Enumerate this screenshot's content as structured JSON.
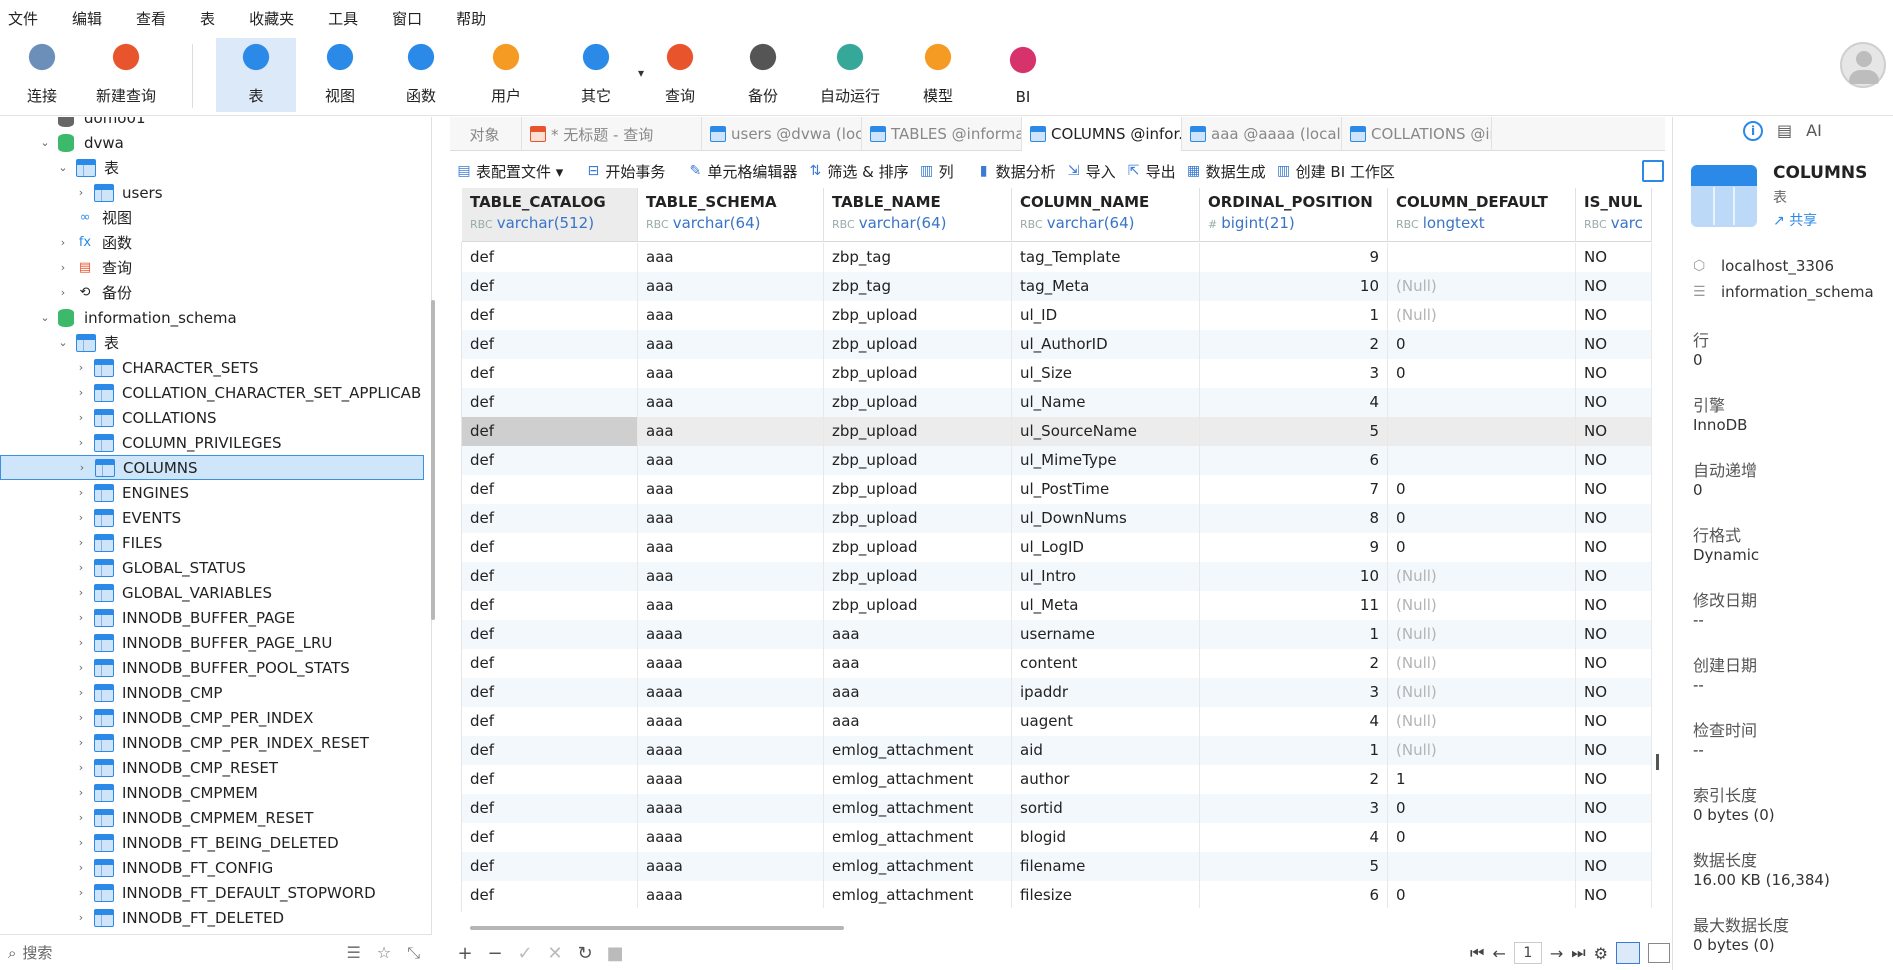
{
  "menu": [
    "文件",
    "编辑",
    "查看",
    "表",
    "收藏夹",
    "工具",
    "窗口",
    "帮助"
  ],
  "toolbar": {
    "buttons": [
      {
        "label": "连接",
        "icon": "plug-connect-icon"
      },
      {
        "label": "新建查询",
        "icon": "new-query-icon"
      },
      {
        "label": "表",
        "icon": "table-icon",
        "active": true
      },
      {
        "label": "视图",
        "icon": "view-glasses-icon"
      },
      {
        "label": "函数",
        "icon": "function-icon"
      },
      {
        "label": "用户",
        "icon": "user-icon"
      },
      {
        "label": "其它",
        "icon": "tools-icon"
      },
      {
        "label": "查询",
        "icon": "query-icon"
      },
      {
        "label": "备份",
        "icon": "backup-icon"
      },
      {
        "label": "自动运行",
        "icon": "robot-icon"
      },
      {
        "label": "模型",
        "icon": "model-icon"
      },
      {
        "label": "BI",
        "icon": "bi-chart-icon"
      }
    ]
  },
  "sidebar": {
    "tree": [
      {
        "label": "domo01",
        "kind": "db-grey",
        "level": 0,
        "expand": ""
      },
      {
        "label": "dvwa",
        "kind": "db",
        "level": 0,
        "expand": "open"
      },
      {
        "label": "表",
        "kind": "table",
        "level": 1,
        "expand": "open"
      },
      {
        "label": "users",
        "kind": "table",
        "level": 2,
        "expand": "closed"
      },
      {
        "label": "视图",
        "kind": "view",
        "level": 1,
        "expand": ""
      },
      {
        "label": "函数",
        "kind": "func",
        "level": 1,
        "expand": "closed"
      },
      {
        "label": "查询",
        "kind": "query",
        "level": 1,
        "expand": "closed"
      },
      {
        "label": "备份",
        "kind": "backup",
        "level": 1,
        "expand": "closed"
      },
      {
        "label": "information_schema",
        "kind": "db",
        "level": 0,
        "expand": "open"
      },
      {
        "label": "表",
        "kind": "table",
        "level": 1,
        "expand": "open"
      },
      {
        "label": "CHARACTER_SETS",
        "kind": "table",
        "level": 2,
        "expand": "closed"
      },
      {
        "label": "COLLATION_CHARACTER_SET_APPLICAB",
        "kind": "table",
        "level": 2,
        "expand": "closed"
      },
      {
        "label": "COLLATIONS",
        "kind": "table",
        "level": 2,
        "expand": "closed"
      },
      {
        "label": "COLUMN_PRIVILEGES",
        "kind": "table",
        "level": 2,
        "expand": "closed"
      },
      {
        "label": "COLUMNS",
        "kind": "table",
        "level": 2,
        "expand": "closed",
        "selected": true
      },
      {
        "label": "ENGINES",
        "kind": "table",
        "level": 2,
        "expand": "closed"
      },
      {
        "label": "EVENTS",
        "kind": "table",
        "level": 2,
        "expand": "closed"
      },
      {
        "label": "FILES",
        "kind": "table",
        "level": 2,
        "expand": "closed"
      },
      {
        "label": "GLOBAL_STATUS",
        "kind": "table",
        "level": 2,
        "expand": "closed"
      },
      {
        "label": "GLOBAL_VARIABLES",
        "kind": "table",
        "level": 2,
        "expand": "closed"
      },
      {
        "label": "INNODB_BUFFER_PAGE",
        "kind": "table",
        "level": 2,
        "expand": "closed"
      },
      {
        "label": "INNODB_BUFFER_PAGE_LRU",
        "kind": "table",
        "level": 2,
        "expand": "closed"
      },
      {
        "label": "INNODB_BUFFER_POOL_STATS",
        "kind": "table",
        "level": 2,
        "expand": "closed"
      },
      {
        "label": "INNODB_CMP",
        "kind": "table",
        "level": 2,
        "expand": "closed"
      },
      {
        "label": "INNODB_CMP_PER_INDEX",
        "kind": "table",
        "level": 2,
        "expand": "closed"
      },
      {
        "label": "INNODB_CMP_PER_INDEX_RESET",
        "kind": "table",
        "level": 2,
        "expand": "closed"
      },
      {
        "label": "INNODB_CMP_RESET",
        "kind": "table",
        "level": 2,
        "expand": "closed"
      },
      {
        "label": "INNODB_CMPMEM",
        "kind": "table",
        "level": 2,
        "expand": "closed"
      },
      {
        "label": "INNODB_CMPMEM_RESET",
        "kind": "table",
        "level": 2,
        "expand": "closed"
      },
      {
        "label": "INNODB_FT_BEING_DELETED",
        "kind": "table",
        "level": 2,
        "expand": "closed"
      },
      {
        "label": "INNODB_FT_CONFIG",
        "kind": "table",
        "level": 2,
        "expand": "closed"
      },
      {
        "label": "INNODB_FT_DEFAULT_STOPWORD",
        "kind": "table",
        "level": 2,
        "expand": "closed"
      },
      {
        "label": "INNODB_FT_DELETED",
        "kind": "table",
        "level": 2,
        "expand": "closed"
      }
    ],
    "search_placeholder": "搜索"
  },
  "tabs": [
    {
      "label": "对象",
      "icon": ""
    },
    {
      "label": "* 无标题 - 查询",
      "icon": "q"
    },
    {
      "label": "users @dvwa (local...",
      "icon": "t"
    },
    {
      "label": "TABLES @informati...",
      "icon": "t"
    },
    {
      "label": "COLUMNS @infor...",
      "icon": "t",
      "active": true
    },
    {
      "label": "aaa @aaaa (localho...",
      "icon": "t"
    },
    {
      "label": "COLLATIONS @inf...",
      "icon": "t"
    }
  ],
  "table_toolbar": [
    {
      "label": "表配置文件 ▾",
      "icon": "table-profile-icon"
    },
    {
      "label": "开始事务",
      "icon": "begin-transaction-icon"
    },
    {
      "label": "单元格编辑器",
      "icon": "cell-editor-icon"
    },
    {
      "label": "筛选 & 排序",
      "icon": "filter-sort-icon"
    },
    {
      "label": "列",
      "icon": "columns-icon"
    },
    {
      "label": "数据分析",
      "icon": "data-analysis-icon"
    },
    {
      "label": "导入",
      "icon": "import-icon"
    },
    {
      "label": "导出",
      "icon": "export-icon"
    },
    {
      "label": "数据生成",
      "icon": "data-generate-icon"
    },
    {
      "label": "创建 BI 工作区",
      "icon": "bi-workspace-icon"
    }
  ],
  "grid": {
    "columns": [
      {
        "name": "TABLE_CATALOG",
        "type": "varchar(512)",
        "tag": "RBC"
      },
      {
        "name": "TABLE_SCHEMA",
        "type": "varchar(64)",
        "tag": "RBC"
      },
      {
        "name": "TABLE_NAME",
        "type": "varchar(64)",
        "tag": "RBC"
      },
      {
        "name": "COLUMN_NAME",
        "type": "varchar(64)",
        "tag": "RBC"
      },
      {
        "name": "ORDINAL_POSITION",
        "type": "bigint(21)",
        "tag": "#"
      },
      {
        "name": "COLUMN_DEFAULT",
        "type": "longtext",
        "tag": "RBC"
      },
      {
        "name": "IS_NUL",
        "type": "varc",
        "tag": "RBC"
      }
    ],
    "rows": [
      [
        "def",
        "aaa",
        "zbp_tag",
        "tag_Template",
        "9",
        "",
        "NO"
      ],
      [
        "def",
        "aaa",
        "zbp_tag",
        "tag_Meta",
        "10",
        "(Null)",
        "NO"
      ],
      [
        "def",
        "aaa",
        "zbp_upload",
        "ul_ID",
        "1",
        "(Null)",
        "NO"
      ],
      [
        "def",
        "aaa",
        "zbp_upload",
        "ul_AuthorID",
        "2",
        "0",
        "NO"
      ],
      [
        "def",
        "aaa",
        "zbp_upload",
        "ul_Size",
        "3",
        "0",
        "NO"
      ],
      [
        "def",
        "aaa",
        "zbp_upload",
        "ul_Name",
        "4",
        "",
        "NO"
      ],
      [
        "def",
        "aaa",
        "zbp_upload",
        "ul_SourceName",
        "5",
        "",
        "NO"
      ],
      [
        "def",
        "aaa",
        "zbp_upload",
        "ul_MimeType",
        "6",
        "",
        "NO"
      ],
      [
        "def",
        "aaa",
        "zbp_upload",
        "ul_PostTime",
        "7",
        "0",
        "NO"
      ],
      [
        "def",
        "aaa",
        "zbp_upload",
        "ul_DownNums",
        "8",
        "0",
        "NO"
      ],
      [
        "def",
        "aaa",
        "zbp_upload",
        "ul_LogID",
        "9",
        "0",
        "NO"
      ],
      [
        "def",
        "aaa",
        "zbp_upload",
        "ul_Intro",
        "10",
        "(Null)",
        "NO"
      ],
      [
        "def",
        "aaa",
        "zbp_upload",
        "ul_Meta",
        "11",
        "(Null)",
        "NO"
      ],
      [
        "def",
        "aaaa",
        "aaa",
        "username",
        "1",
        "(Null)",
        "NO"
      ],
      [
        "def",
        "aaaa",
        "aaa",
        "content",
        "2",
        "(Null)",
        "NO"
      ],
      [
        "def",
        "aaaa",
        "aaa",
        "ipaddr",
        "3",
        "(Null)",
        "NO"
      ],
      [
        "def",
        "aaaa",
        "aaa",
        "uagent",
        "4",
        "(Null)",
        "NO"
      ],
      [
        "def",
        "aaaa",
        "emlog_attachment",
        "aid",
        "1",
        "(Null)",
        "NO"
      ],
      [
        "def",
        "aaaa",
        "emlog_attachment",
        "author",
        "2",
        "1",
        "NO"
      ],
      [
        "def",
        "aaaa",
        "emlog_attachment",
        "sortid",
        "3",
        "0",
        "NO"
      ],
      [
        "def",
        "aaaa",
        "emlog_attachment",
        "blogid",
        "4",
        "0",
        "NO"
      ],
      [
        "def",
        "aaaa",
        "emlog_attachment",
        "filename",
        "5",
        "",
        "NO"
      ],
      [
        "def",
        "aaaa",
        "emlog_attachment",
        "filesize",
        "6",
        "0",
        "NO"
      ]
    ]
  },
  "pager": {
    "page": "1"
  },
  "right_panel": {
    "title": "COLUMNS",
    "subtitle": "表",
    "share": "共享",
    "connection": "localhost_3306",
    "schema": "information_schema",
    "props": [
      {
        "label": "行",
        "value": "0"
      },
      {
        "label": "引擎",
        "value": "InnoDB"
      },
      {
        "label": "自动递增",
        "value": "0"
      },
      {
        "label": "行格式",
        "value": "Dynamic"
      },
      {
        "label": "修改日期",
        "value": "--"
      },
      {
        "label": "创建日期",
        "value": "--"
      },
      {
        "label": "检查时间",
        "value": "--"
      },
      {
        "label": "索引长度",
        "value": "0 bytes (0)"
      },
      {
        "label": "数据长度",
        "value": "16.00 KB (16,384)"
      },
      {
        "label": "最大数据长度",
        "value": "0 bytes (0)"
      }
    ]
  }
}
